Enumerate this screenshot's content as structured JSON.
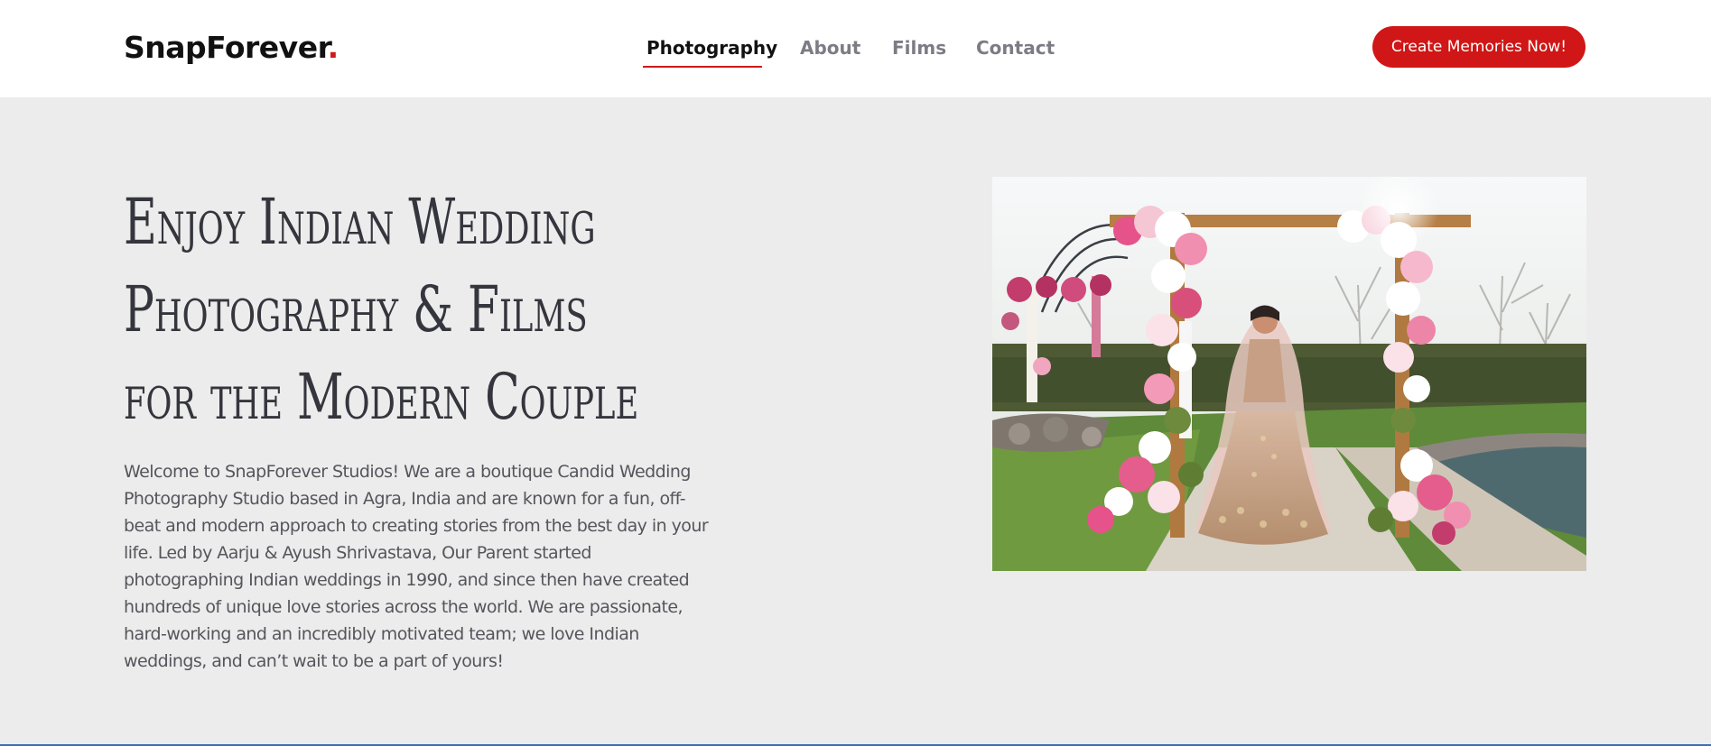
{
  "header": {
    "logo_text": "SnapForever",
    "logo_dot": ".",
    "nav": [
      {
        "label": "Photography",
        "active": true
      },
      {
        "label": "About",
        "active": false
      },
      {
        "label": "Films",
        "active": false
      },
      {
        "label": "Contact",
        "active": false
      }
    ],
    "cta_label": "Create Memories Now!"
  },
  "hero": {
    "title_lines": [
      "Enjoy Indian Wedding",
      "Photography & Films",
      "for the Modern Couple"
    ],
    "intro": "Welcome to SnapForever Studios! We are a boutique Candid Wedding Photography Studio based in Agra, India and are known for a fun, off-beat and modern approach to creating stories from the best day in your life. Led by Aarju & Ayush Shrivastava, Our Parent started photographing Indian weddings in 1990, and since then have created hundreds of unique love stories across the world. We are passionate, hard-working and an incredibly motivated team; we love Indian weddings, and can’t wait to be a part of yours!"
  },
  "colors": {
    "accent": "#d01616",
    "background": "#ececec",
    "header_bg": "#ffffff",
    "title_text": "#35353d",
    "body_text": "#55555c",
    "nav_inactive": "#7c7c85",
    "bottom_border": "#3f6eb3"
  }
}
